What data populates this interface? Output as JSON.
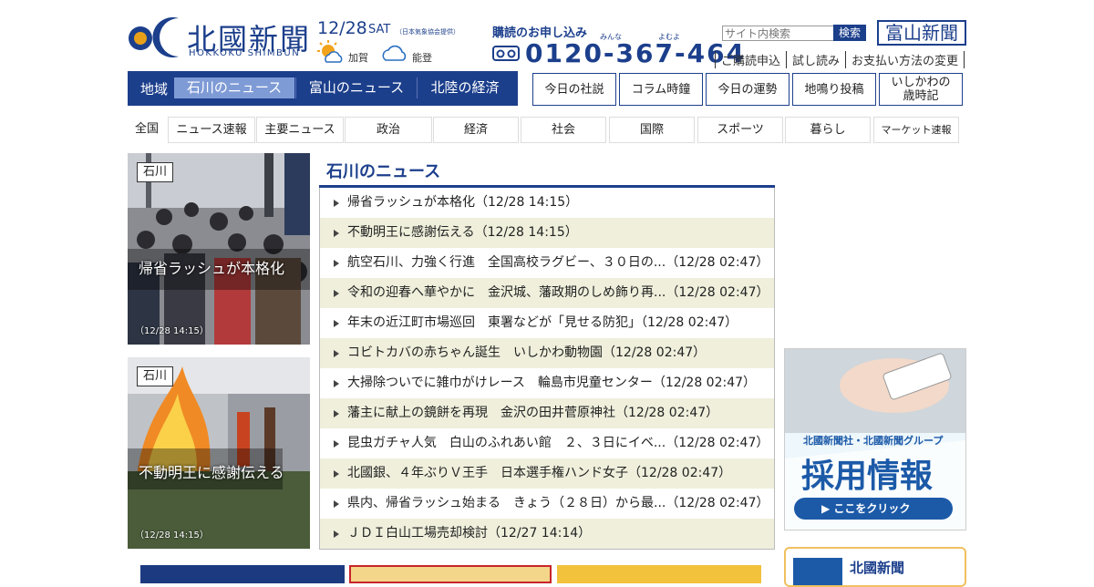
{
  "header": {
    "logo_text": "北國新聞",
    "logo_sub": "HOKKOKU SHIMBUN",
    "date": "12/28",
    "day_of_week": "SAT",
    "weather_source": "（日本気象協会提供）",
    "weather": [
      {
        "region": "加賀",
        "icon": "sun-cloud-icon"
      },
      {
        "region": "能登",
        "icon": "cloud-icon"
      }
    ],
    "subscription_title": "購読のお申し込み",
    "ruby_1": "みんな",
    "ruby_2": "よむよ",
    "phone": "0120-367-464",
    "search_placeholder": "サイト内検索",
    "search_button": "検索",
    "toyama_logo": "富山新聞",
    "top_links": [
      "ご購読申込",
      "試し読み",
      "お支払い方法の変更"
    ]
  },
  "region_nav": {
    "label": "地域",
    "tabs": [
      "石川のニュース",
      "富山のニュース",
      "北陸の経済"
    ],
    "active_index": 0
  },
  "column_buttons": [
    "今日の社説",
    "コラム時鐘",
    "今日の運勢",
    "地鳴り投稿",
    "いしかわの\n歳時記"
  ],
  "categories": [
    "全国",
    "ニュース速報",
    "主要ニュース",
    "政治",
    "経済",
    "社会",
    "国際",
    "スポーツ",
    "暮らし",
    "マーケット速報"
  ],
  "photos": [
    {
      "badge": "石川",
      "title": "帰省ラッシュが本格化",
      "time": "（12/28 14:15）"
    },
    {
      "badge": "石川",
      "title": "不動明王に感謝伝える",
      "time": "（12/28 14:15）"
    }
  ],
  "news": {
    "heading": "石川のニュース",
    "items": [
      "帰省ラッシュが本格化（12/28 14:15）",
      "不動明王に感謝伝える（12/28 14:15）",
      "航空石川、力強く行進　全国高校ラグビー、３０日の...（12/28 02:47）",
      "令和の迎春へ華やかに　金沢城、藩政期のしめ飾り再...（12/28 02:47）",
      "年末の近江町市場巡回　東署などが「見せる防犯」（12/28 02:47）",
      "コビトカバの赤ちゃん誕生　いしかわ動物園（12/28 02:47）",
      "大掃除ついでに雑巾がけレース　輪島市児童センター（12/28 02:47）",
      "藩主に献上の鏡餅を再現　金沢の田井菅原神社（12/28 02:47）",
      "昆虫ガチャ人気　白山のふれあい館　２、３日にイベ...（12/28 02:47）",
      "北國銀、４年ぶりＶ王手　日本選手権ハンド女子（12/28 02:47）",
      "県内、帰省ラッシュ始まる　きょう（２８日）から最...（12/28 02:47）",
      "ＪＤＩ白山工場売却検討（12/27 14:14）"
    ]
  },
  "ads": {
    "recruit_line1": "北國新聞社・北國新聞グループ",
    "recruit_line2": "採用情報",
    "recruit_button": "▶ ここをクリック",
    "small_title": "北國新聞"
  }
}
